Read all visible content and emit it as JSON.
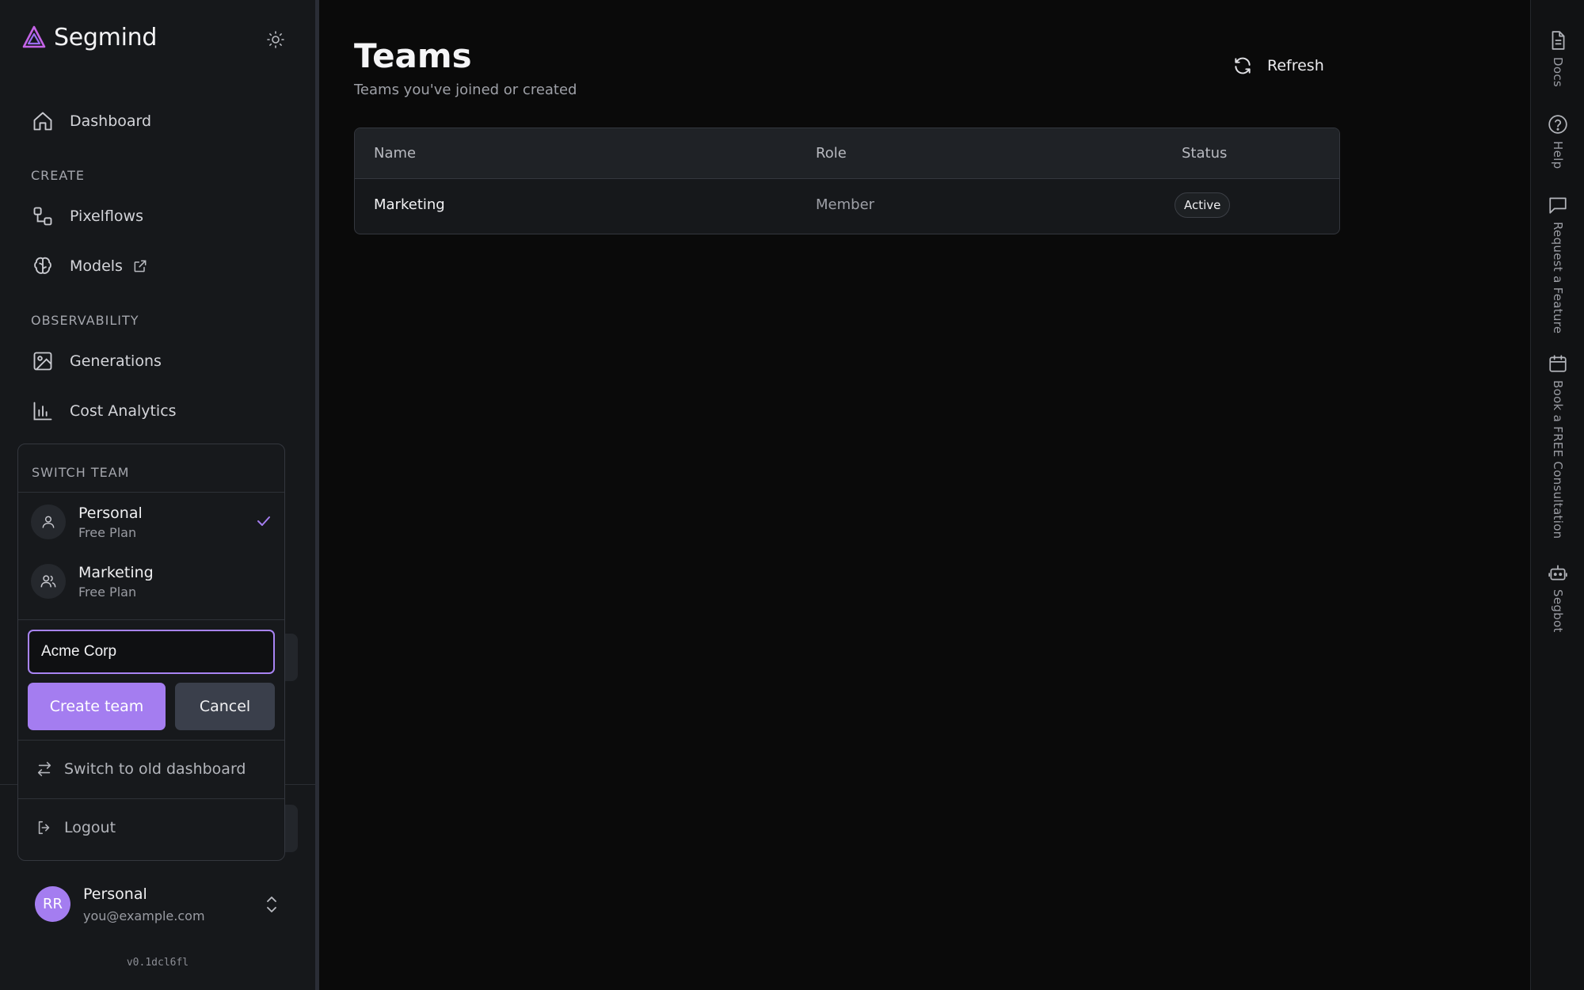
{
  "brand": {
    "name": "Segmind"
  },
  "sidebar": {
    "dashboard": "Dashboard",
    "create_label": "CREATE",
    "pixelflows": "Pixelflows",
    "models": "Models",
    "observability_label": "OBSERVABILITY",
    "generations": "Generations",
    "cost_analytics": "Cost Analytics"
  },
  "switch_team": {
    "header": "SWITCH TEAM",
    "teams": [
      {
        "name": "Personal",
        "plan": "Free Plan",
        "selected": true
      },
      {
        "name": "Marketing",
        "plan": "Free Plan",
        "selected": false
      }
    ],
    "input_value": "Acme Corp",
    "create_label": "Create team",
    "cancel_label": "Cancel",
    "old_dashboard": "Switch to old dashboard",
    "logout": "Logout"
  },
  "user": {
    "initials": "RR",
    "name": "Personal",
    "email": "you@example.com"
  },
  "version": "v0.1dcl6fl",
  "main": {
    "title": "Teams",
    "subtitle": "Teams you've joined or created",
    "refresh_label": "Refresh",
    "table": {
      "columns": [
        "Name",
        "Role",
        "Status"
      ],
      "rows": [
        {
          "name": "Marketing",
          "role": "Member",
          "status": "Active"
        }
      ]
    }
  },
  "rail": [
    "Docs",
    "Help",
    "Request a Feature",
    "Book a FREE Consultation",
    "Segbot"
  ],
  "colors": {
    "accent": "#a47df0",
    "bg": "#0a0a0a",
    "sidebar": "#16181b"
  }
}
